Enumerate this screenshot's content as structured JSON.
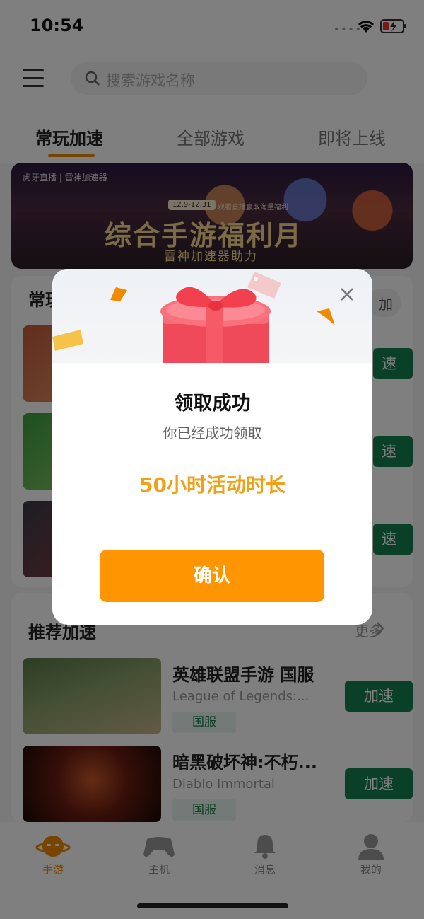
{
  "status_bar": {
    "time": "10:54",
    "signal_dots": "••••"
  },
  "search": {
    "placeholder": "搜索游戏名称"
  },
  "tabs": [
    {
      "label": "常玩加速",
      "active": true
    },
    {
      "label": "全部游戏",
      "active": false
    },
    {
      "label": "即将上线",
      "active": false
    }
  ],
  "banner": {
    "logos": "虎牙直播 | 雷神加速器",
    "date": "12.9-12.31",
    "promo_text": "观看直播赢取海量福利",
    "title": "综合手游福利月",
    "subtitle": "雷神加速器助力"
  },
  "frequent_section": {
    "title": "常玩",
    "right_label": "加"
  },
  "frequent_buttons": [
    "速",
    "速",
    "速"
  ],
  "recommend_section": {
    "title": "推荐加速",
    "more_label": "更多"
  },
  "recommend_games": [
    {
      "name": "英雄联盟手游 国服",
      "subtitle": "League of Legends:...",
      "tag": "国服",
      "button": "加速"
    },
    {
      "name": "暗黑破坏神:不朽...",
      "subtitle": "Diablo Immortal",
      "tag": "国服",
      "button": "加速"
    }
  ],
  "bottom_nav": [
    {
      "label": "手游",
      "icon": "planet-icon",
      "active": true
    },
    {
      "label": "主机",
      "icon": "gamepad-icon",
      "active": false
    },
    {
      "label": "消息",
      "icon": "bell-icon",
      "active": false
    },
    {
      "label": "我的",
      "icon": "user-icon",
      "active": false
    }
  ],
  "modal": {
    "title": "领取成功",
    "subtitle": "你已经成功领取",
    "reward": "50小时活动时长",
    "confirm_label": "确认"
  },
  "colors": {
    "accent_orange": "#ff9500",
    "reward_text": "#f0a11a",
    "accelerate_green": "#15804f",
    "tab_indicator": "#f08a00"
  }
}
